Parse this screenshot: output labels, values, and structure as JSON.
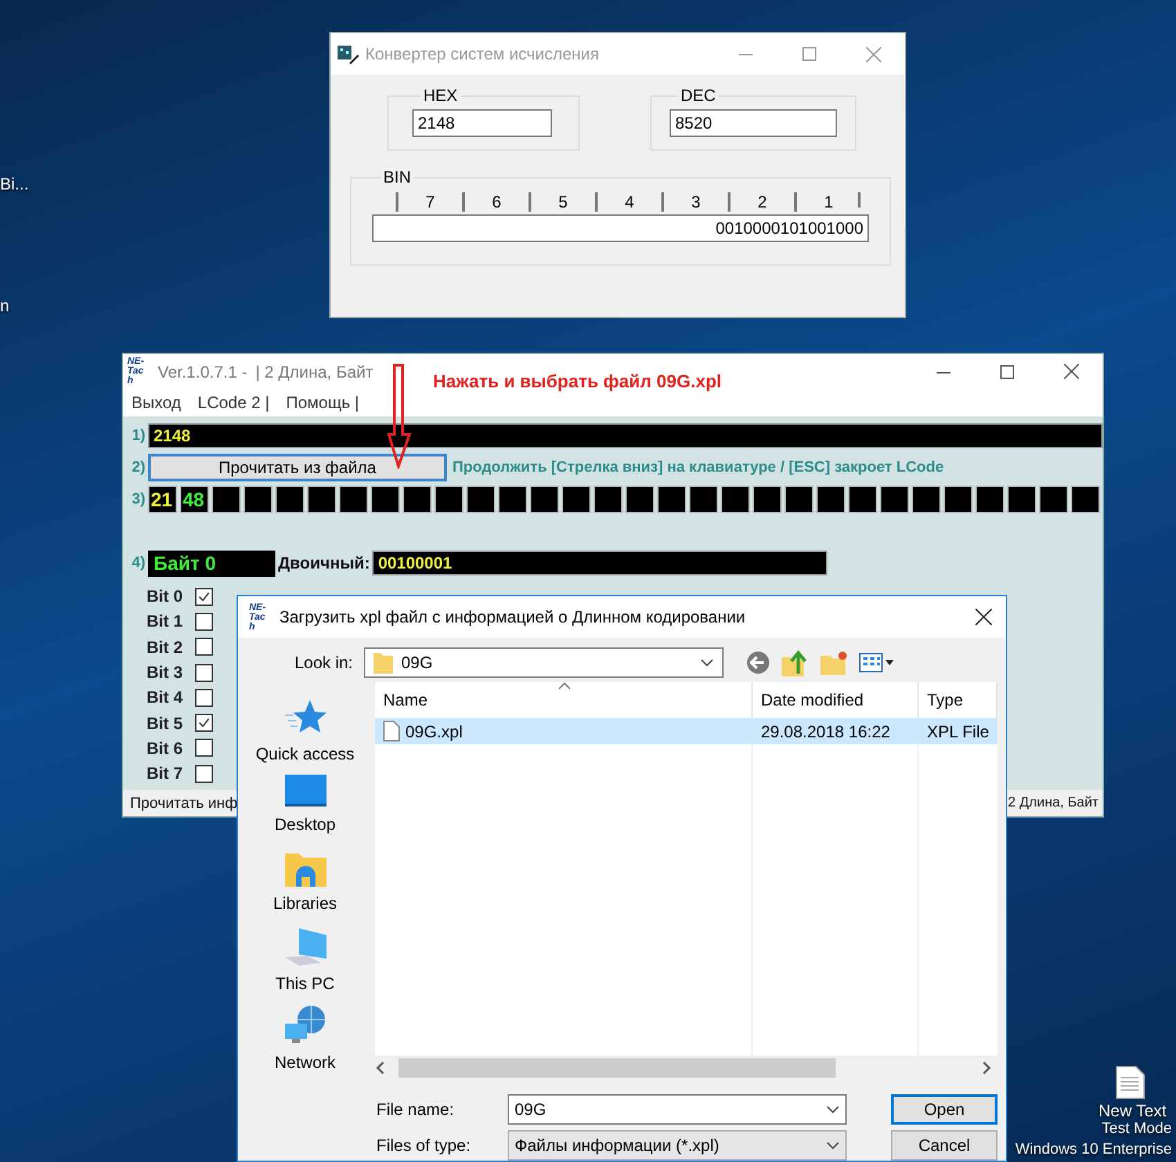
{
  "desktop": {
    "icons": [
      {
        "label": "Bi..."
      },
      {
        "label": "n"
      },
      {
        "label": "New Text"
      }
    ],
    "watermark": [
      "Test Mode",
      "Windows 10 Enterprise"
    ]
  },
  "converter_window": {
    "title": "Конвертер систем исчисления",
    "hex": {
      "label": "HEX",
      "value": "2148"
    },
    "dec": {
      "label": "DEC",
      "value": "8520"
    },
    "bin": {
      "label": "BIN",
      "bit_groups": [
        "7",
        "6",
        "5",
        "4",
        "3",
        "2",
        "1"
      ],
      "value": "0010000101001000"
    }
  },
  "lcode_window": {
    "logo": "NE-Tach",
    "title": "Ver.1.0.7.1 -",
    "subtitle": "| 2 Длина, Байт",
    "menu": [
      "Выход",
      "LCode 2 |",
      "Помощь |"
    ],
    "row1": {
      "number": "1)",
      "value": "2148"
    },
    "row2": {
      "number": "2)",
      "button": "Прочитать из файла",
      "hint": "Продолжить [Стрелка вниз] на клавиатуре / [ESC] закроет LCode"
    },
    "row3": {
      "number": "3)",
      "cells": [
        {
          "kind": "value",
          "text": "21",
          "color": "#f0f03c"
        },
        {
          "kind": "value",
          "text": "48",
          "color": "#3cf03c"
        },
        {
          "kind": "empty"
        },
        {
          "kind": "empty"
        },
        {
          "kind": "empty"
        },
        {
          "kind": "empty"
        },
        {
          "kind": "empty"
        },
        {
          "kind": "empty"
        },
        {
          "kind": "empty"
        },
        {
          "kind": "empty"
        },
        {
          "kind": "empty"
        },
        {
          "kind": "empty"
        },
        {
          "kind": "empty"
        },
        {
          "kind": "empty"
        },
        {
          "kind": "empty"
        },
        {
          "kind": "empty"
        },
        {
          "kind": "empty"
        },
        {
          "kind": "empty"
        },
        {
          "kind": "empty"
        },
        {
          "kind": "empty"
        },
        {
          "kind": "empty"
        },
        {
          "kind": "empty"
        },
        {
          "kind": "empty"
        },
        {
          "kind": "empty"
        },
        {
          "kind": "empty"
        },
        {
          "kind": "empty"
        },
        {
          "kind": "empty"
        },
        {
          "kind": "empty"
        },
        {
          "kind": "empty"
        },
        {
          "kind": "empty"
        }
      ]
    },
    "row4": {
      "number": "4)",
      "byte_label": "Байт 0",
      "binary_label": "Двоичный:",
      "binary_value": "00100001"
    },
    "bits": [
      {
        "label": "Bit 0",
        "checked": true
      },
      {
        "label": "Bit 1",
        "checked": false
      },
      {
        "label": "Bit 2",
        "checked": false
      },
      {
        "label": "Bit 3",
        "checked": false
      },
      {
        "label": "Bit 4",
        "checked": false
      },
      {
        "label": "Bit 5",
        "checked": true
      },
      {
        "label": "Bit 6",
        "checked": false
      },
      {
        "label": "Bit 7",
        "checked": false
      }
    ],
    "status_bar": [
      "Прочитать инф",
      "2 Длина, Байт"
    ]
  },
  "annotation": {
    "text": "Нажать и выбрать файл 09G.xpl"
  },
  "file_dialog": {
    "logo": "NE-Tach",
    "title": "Загрузить xpl файл с информацией о Длинном кодировании",
    "look_in": {
      "label": "Look in:",
      "value": "09G"
    },
    "places": [
      {
        "kind": "quick_access",
        "label": "Quick access"
      },
      {
        "kind": "desktop",
        "label": "Desktop"
      },
      {
        "kind": "libraries",
        "label": "Libraries"
      },
      {
        "kind": "this_pc",
        "label": "This PC"
      },
      {
        "kind": "network",
        "label": "Network"
      }
    ],
    "columns": [
      "Name",
      "Date modified",
      "Type"
    ],
    "rows": [
      {
        "name": "09G.xpl",
        "date": "29.08.2018 16:22",
        "type": "XPL File",
        "selected": true
      }
    ],
    "file_name": {
      "label": "File name:",
      "value": "09G"
    },
    "file_type": {
      "label": "Files of type:",
      "value": "Файлы информации (*.xpl)"
    },
    "buttons": [
      {
        "label": "Open",
        "default": true
      },
      {
        "label": "Cancel",
        "default": false
      }
    ]
  }
}
